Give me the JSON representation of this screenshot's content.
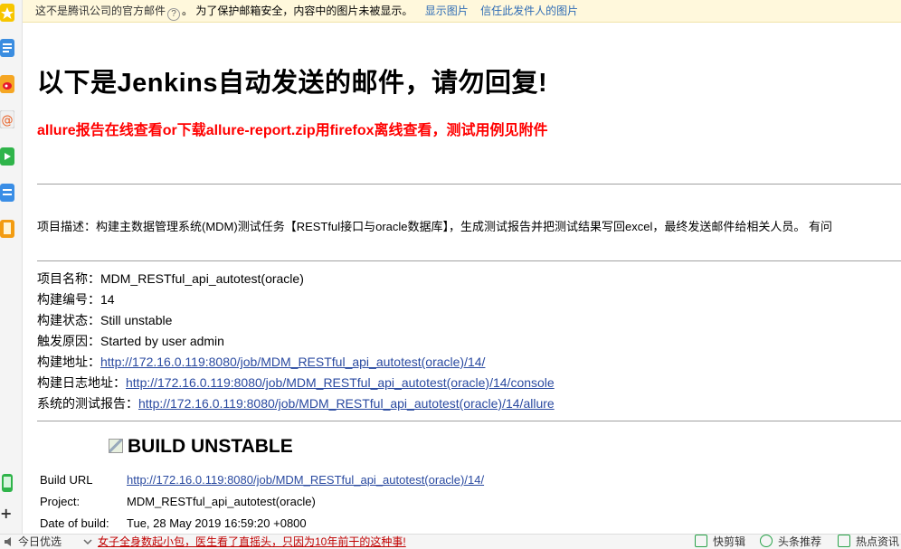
{
  "notice": {
    "text": "这不是腾讯公司的官方邮件",
    "text2": "。 为了保护邮箱安全，内容中的图片未被显示。",
    "help_icon": "question-circle-icon",
    "show_images": "显示图片",
    "trust_sender": "信任此发件人的图片"
  },
  "mail": {
    "heading": "以下是Jenkins自动发送的邮件，请勿回复!",
    "subheading": "allure报告在线查看or下载allure-report.zip用firefox离线查看，测试用例见附件",
    "description": "项目描述：构建主数据管理系统(MDM)测试任务【RESTful接口与oracle数据库】，生成测试报告并把测试结果写回excel，最终发送邮件给相关人员。 有问",
    "info": {
      "project_name_label": "项目名称：",
      "project_name": "MDM_RESTful_api_autotest(oracle)",
      "build_number_label": "构建编号：",
      "build_number": "14",
      "build_status_label": "构建状态：",
      "build_status": "Still unstable",
      "trigger_label": "触发原因：",
      "trigger": "Started by user admin",
      "build_url_label": "构建地址：",
      "build_url": "http://172.16.0.119:8080/job/MDM_RESTful_api_autotest(oracle)/14/",
      "log_url_label": "构建日志地址：",
      "log_url": "http://172.16.0.119:8080/job/MDM_RESTful_api_autotest(oracle)/14/console",
      "report_url_label": "系统的测试报告：",
      "report_url": "http://172.16.0.119:8080/job/MDM_RESTful_api_autotest(oracle)/14/allure"
    },
    "build_title": "BUILD UNSTABLE",
    "table": {
      "build_url_label": "Build URL",
      "build_url": "http://172.16.0.119:8080/job/MDM_RESTful_api_autotest(oracle)/14/",
      "project_label": "Project:",
      "project": "MDM_RESTful_api_autotest(oracle)",
      "date_label": "Date of build:",
      "date": "Tue, 28 May 2019 16:59:20 +0800"
    }
  },
  "status_bar": {
    "today": "今日优选",
    "news": "女子全身数起小包，医生看了直摇头，只因为10年前干的这种事!",
    "clip": "快剪辑",
    "headlines": "头条推荐",
    "hot": "热点资讯"
  },
  "rail_icons": [
    "star-icon",
    "document-icon",
    "weibo-icon",
    "mail-at-icon",
    "video-icon",
    "note-icon",
    "bookmark-icon",
    "phone-icon",
    "plus-icon"
  ],
  "colors": {
    "notice_bg": "#fff8dc",
    "link": "#2a4aa0",
    "red_heading": "#ff0000",
    "status_green": "#2aa34a"
  }
}
